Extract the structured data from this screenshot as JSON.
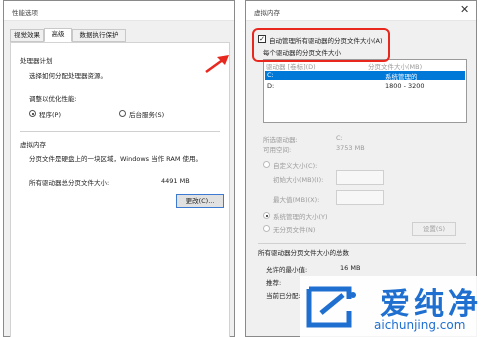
{
  "left_window": {
    "title": "性能选项",
    "tabs": [
      "视觉效果",
      "高级",
      "数据执行保护"
    ],
    "section_processor": {
      "heading": "处理器计划",
      "description": "选择如何分配处理器资源。",
      "adjust_label": "调整以优化性能:",
      "option_programs": "程序(P)",
      "option_background": "后台服务(S)"
    },
    "section_vm": {
      "heading": "虚拟内存",
      "description": "分页文件是硬盘上的一块区域，Windows 当作 RAM 使用。",
      "total_label": "所有驱动器总分页文件大小:",
      "total_value": "4491 MB",
      "change_button": "更改(C)..."
    }
  },
  "right_window": {
    "title": "虚拟内存",
    "auto_manage_label": "自动管理所有驱动器的分页文件大小(A)",
    "per_drive_heading": "每个驱动器的分页文件大小",
    "col_drive": "驱动器 [卷标](D)",
    "col_size": "分页文件大小(MB)",
    "drives": [
      {
        "drive": "C:",
        "size": "系统管理的"
      },
      {
        "drive": "D:",
        "size": "1800 - 3200"
      }
    ],
    "selected_drive_label": "所选驱动器:",
    "selected_drive_value": "C:",
    "available_space_label": "可用空间:",
    "available_space_value": "3753 MB",
    "custom_size_label": "自定义大小(C):",
    "initial_size_label": "初始大小(MB)(I):",
    "max_size_label": "最大值(MB)(X):",
    "system_managed_label": "系统管理的大小(Y)",
    "no_paging_label": "无分页文件(N)",
    "set_button": "设置(S)",
    "total_heading": "所有驱动器分页文件大小的总数",
    "min_allowed_label": "允许的最小值:",
    "min_allowed_value": "16 MB",
    "recommended_label": "推荐:",
    "current_allocated_label": "当前已分配:"
  },
  "watermark": {
    "brand_cn": "爱纯净",
    "url": "aichunjing.com"
  },
  "colors": {
    "highlight_red": "#e8281e",
    "selection_blue": "#0078d7",
    "logo_blue": "#1e6fd0"
  }
}
